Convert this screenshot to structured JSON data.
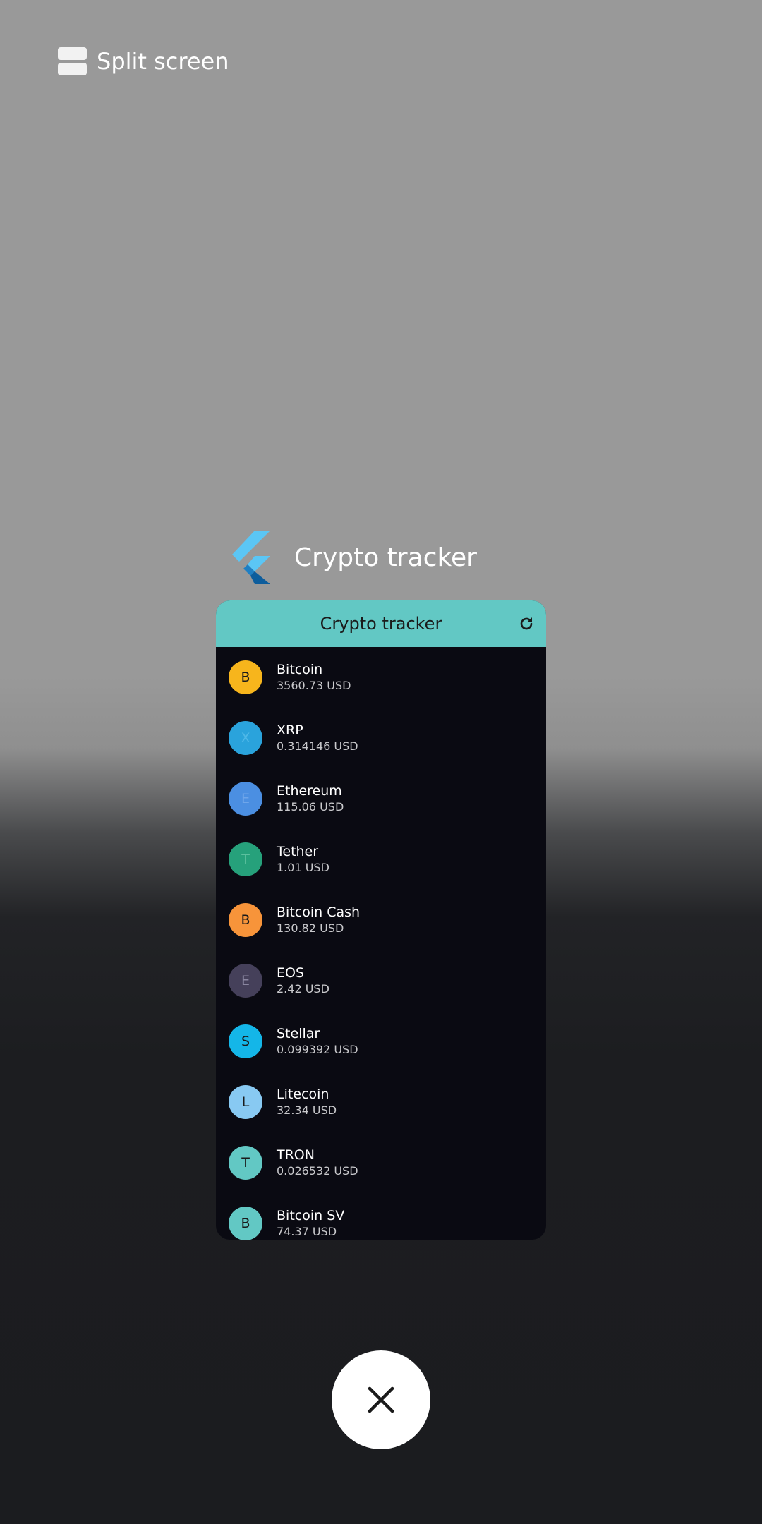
{
  "split_screen": {
    "label": "Split screen"
  },
  "app": {
    "title": "Crypto tracker"
  },
  "card": {
    "title": "Crypto tracker",
    "coins": [
      {
        "initial": "B",
        "name": "Bitcoin",
        "price": "3560.73 USD",
        "color": "#f7b51c",
        "text_color": "#1a1a1a"
      },
      {
        "initial": "X",
        "name": "XRP",
        "price": "0.314146 USD",
        "color": "#2aa3dc",
        "text_color": "#4fb8e8"
      },
      {
        "initial": "E",
        "name": "Ethereum",
        "price": "115.06 USD",
        "color": "#4b8fe2",
        "text_color": "#6fa6ea"
      },
      {
        "initial": "T",
        "name": "Tether",
        "price": "1.01 USD",
        "color": "#26a17b",
        "text_color": "#5cc09e"
      },
      {
        "initial": "B",
        "name": "Bitcoin Cash",
        "price": "130.82 USD",
        "color": "#f7943a",
        "text_color": "#1a1a1a"
      },
      {
        "initial": "E",
        "name": "EOS",
        "price": "2.42 USD",
        "color": "#45405a",
        "text_color": "#8a86a0"
      },
      {
        "initial": "S",
        "name": "Stellar",
        "price": "0.099392 USD",
        "color": "#14b6e8",
        "text_color": "#1a1a1a"
      },
      {
        "initial": "L",
        "name": "Litecoin",
        "price": "32.34 USD",
        "color": "#88c9f2",
        "text_color": "#1a1a1a"
      },
      {
        "initial": "T",
        "name": "TRON",
        "price": "0.026532 USD",
        "color": "#62c8c4",
        "text_color": "#1a1a1a"
      },
      {
        "initial": "B",
        "name": "Bitcoin SV",
        "price": "74.37 USD",
        "color": "#62c8c4",
        "text_color": "#1a1a1a"
      }
    ]
  }
}
